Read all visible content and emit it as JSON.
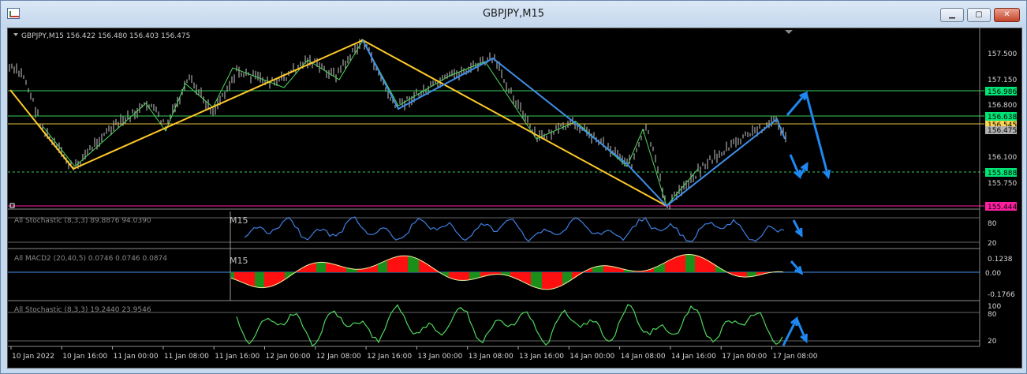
{
  "window": {
    "title": "GBPJPY,M15",
    "minimize_glyph": "▁",
    "maximize_glyph": "▢",
    "close_glyph": "✕"
  },
  "main": {
    "header": "GBPJPY,M15  156.422 156.480 156.403 156.475",
    "price_labels": [
      "157.500",
      "157.150",
      "156.800",
      "156.450",
      "156.100",
      "155.750"
    ],
    "price_tags": [
      {
        "text": "156.986",
        "color": "#00e676"
      },
      {
        "text": "156.638",
        "color": "#00e676"
      },
      {
        "text": "156.545",
        "color": "#ffd54f"
      },
      {
        "text": "156.475",
        "color": "#b0b0b0"
      },
      {
        "text": "155.888",
        "color": "#00e676"
      },
      {
        "text": "155.444",
        "color": "#ff1fa0"
      }
    ]
  },
  "stoch1": {
    "title": "All Stochastic (8,3,3) 89.8876 94.0390",
    "tf": "M15",
    "labels": [
      "80",
      "20"
    ]
  },
  "macd": {
    "title": "All MACD2 (20,40,5) 0.0746 0.0746 0.0874",
    "tf": "M15",
    "labels": [
      "0.1238",
      "0.00",
      "-0.1766"
    ]
  },
  "stoch2": {
    "title": "All Stochastic (8,3,3) 19.2440 23.9546",
    "labels": [
      "100",
      "80",
      "20"
    ]
  },
  "time_axis": [
    "10 Jan 2022",
    "10 Jan 16:00",
    "11 Jan 00:00",
    "11 Jan 08:00",
    "11 Jan 16:00",
    "12 Jan 00:00",
    "12 Jan 08:00",
    "12 Jan 16:00",
    "13 Jan 00:00",
    "13 Jan 08:00",
    "13 Jan 16:00",
    "14 Jan 00:00",
    "14 Jan 08:00",
    "14 Jan 16:00",
    "17 Jan 00:00",
    "17 Jan 08:00"
  ],
  "colors": {
    "zigzag_yellow": "#ffc928",
    "zigzag_blue": "#3f8fe8",
    "stoch_blue": "#3f7fe0",
    "stoch_green": "#4fd65c",
    "macd_red": "#ff1010",
    "macd_green": "#1a8f1a",
    "arrow": "#1e88f0"
  }
}
